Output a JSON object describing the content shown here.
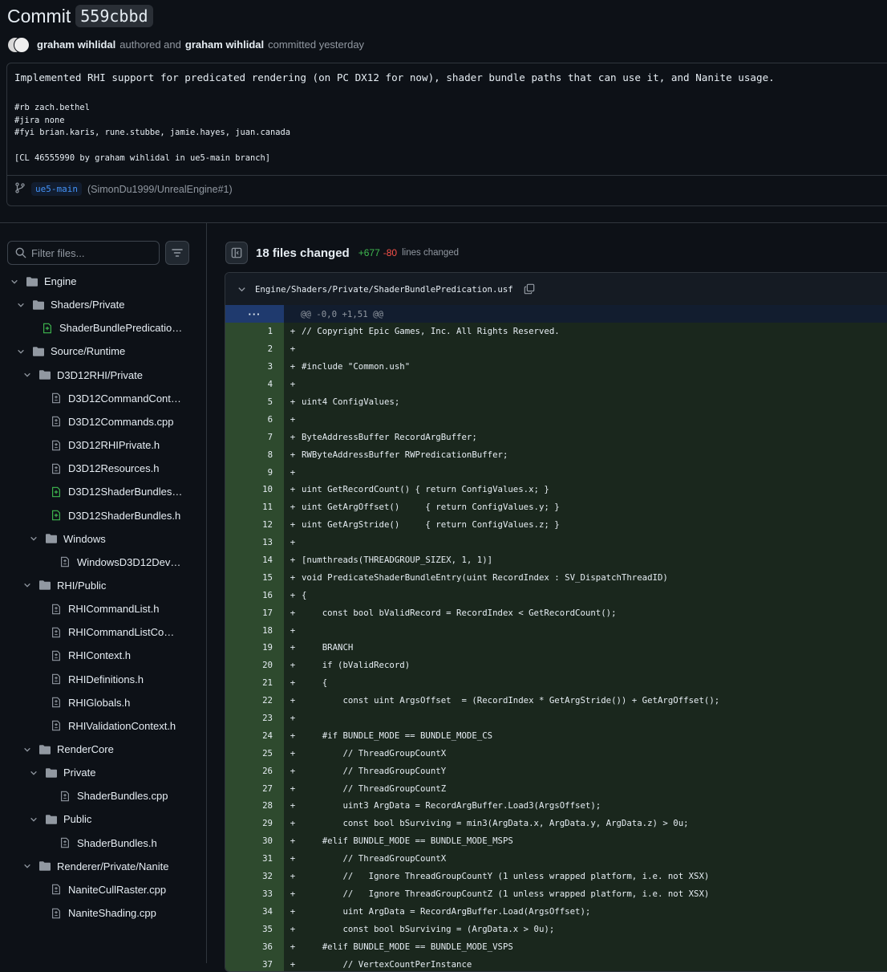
{
  "commit": {
    "title_prefix": "Commit",
    "sha": "559cbbd",
    "author": "graham wihlidal",
    "authored_text": "authored and",
    "committer": "graham wihlidal",
    "committed_text": "committed yesterday",
    "message_title": "Implemented RHI support for predicated rendering (on PC DX12 for now), shader bundle paths that can use it, and Nanite usage.",
    "message_body": "#rb zach.bethel\n#jira none\n#fyi brian.karis, rune.stubbe, jamie.hayes, juan.canada\n\n[CL 46555990 by graham wihlidal in ue5-main branch]",
    "branch": "ue5-main",
    "pr_ref": "(SimonDu1999/UnrealEngine#1)"
  },
  "sidebar": {
    "filter_placeholder": "Filter files...",
    "tree": [
      {
        "label": "Engine",
        "type": "folder",
        "depth": 0
      },
      {
        "label": "Shaders/Private",
        "type": "folder",
        "depth": 1
      },
      {
        "label": "ShaderBundlePredication....",
        "type": "file-added",
        "depth": 2
      },
      {
        "label": "Source/Runtime",
        "type": "folder",
        "depth": 1
      },
      {
        "label": "D3D12RHI/Private",
        "type": "folder",
        "depth": 2
      },
      {
        "label": "D3D12CommandContext.h",
        "type": "file-modified",
        "depth": 3
      },
      {
        "label": "D3D12Commands.cpp",
        "type": "file-modified",
        "depth": 3
      },
      {
        "label": "D3D12RHIPrivate.h",
        "type": "file-modified",
        "depth": 3
      },
      {
        "label": "D3D12Resources.h",
        "type": "file-modified",
        "depth": 3
      },
      {
        "label": "D3D12ShaderBundles.cpp",
        "type": "file-added",
        "depth": 3
      },
      {
        "label": "D3D12ShaderBundles.h",
        "type": "file-added",
        "depth": 3
      },
      {
        "label": "Windows",
        "type": "folder",
        "depth": 3
      },
      {
        "label": "WindowsD3D12Device.c...",
        "type": "file-modified",
        "depth": 4
      },
      {
        "label": "RHI/Public",
        "type": "folder",
        "depth": 2
      },
      {
        "label": "RHICommandList.h",
        "type": "file-modified",
        "depth": 3
      },
      {
        "label": "RHICommandListComma...",
        "type": "file-modified",
        "depth": 3
      },
      {
        "label": "RHIContext.h",
        "type": "file-modified",
        "depth": 3
      },
      {
        "label": "RHIDefinitions.h",
        "type": "file-modified",
        "depth": 3
      },
      {
        "label": "RHIGlobals.h",
        "type": "file-modified",
        "depth": 3
      },
      {
        "label": "RHIValidationContext.h",
        "type": "file-modified",
        "depth": 3
      },
      {
        "label": "RenderCore",
        "type": "folder",
        "depth": 2
      },
      {
        "label": "Private",
        "type": "folder",
        "depth": 3
      },
      {
        "label": "ShaderBundles.cpp",
        "type": "file-modified",
        "depth": 4
      },
      {
        "label": "Public",
        "type": "folder",
        "depth": 3
      },
      {
        "label": "ShaderBundles.h",
        "type": "file-modified",
        "depth": 4
      },
      {
        "label": "Renderer/Private/Nanite",
        "type": "folder",
        "depth": 2
      },
      {
        "label": "NaniteCullRaster.cpp",
        "type": "file-modified",
        "depth": 3
      },
      {
        "label": "NaniteShading.cpp",
        "type": "file-modified",
        "depth": 3
      }
    ]
  },
  "summary": {
    "files_changed": "18 files changed",
    "additions": "+677",
    "deletions": "-80",
    "lines_changed": "lines changed"
  },
  "diff": {
    "file_path": "Engine/Shaders/Private/ShaderBundlePredication.usf",
    "hunk_expand": "···",
    "hunk_header": "@@ -0,0 +1,51 @@",
    "lines": [
      {
        "n": "1",
        "t": "// Copyright Epic Games, Inc. All Rights Reserved."
      },
      {
        "n": "2",
        "t": ""
      },
      {
        "n": "3",
        "t": "#include \"Common.ush\""
      },
      {
        "n": "4",
        "t": ""
      },
      {
        "n": "5",
        "t": "uint4 ConfigValues;"
      },
      {
        "n": "6",
        "t": ""
      },
      {
        "n": "7",
        "t": "ByteAddressBuffer RecordArgBuffer;"
      },
      {
        "n": "8",
        "t": "RWByteAddressBuffer RWPredicationBuffer;"
      },
      {
        "n": "9",
        "t": ""
      },
      {
        "n": "10",
        "t": "uint GetRecordCount() { return ConfigValues.x; }"
      },
      {
        "n": "11",
        "t": "uint GetArgOffset()     { return ConfigValues.y; }"
      },
      {
        "n": "12",
        "t": "uint GetArgStride()     { return ConfigValues.z; }"
      },
      {
        "n": "13",
        "t": ""
      },
      {
        "n": "14",
        "t": "[numthreads(THREADGROUP_SIZEX, 1, 1)]"
      },
      {
        "n": "15",
        "t": "void PredicateShaderBundleEntry(uint RecordIndex : SV_DispatchThreadID)"
      },
      {
        "n": "16",
        "t": "{"
      },
      {
        "n": "17",
        "t": "    const bool bValidRecord = RecordIndex < GetRecordCount();"
      },
      {
        "n": "18",
        "t": ""
      },
      {
        "n": "19",
        "t": "    BRANCH"
      },
      {
        "n": "20",
        "t": "    if (bValidRecord)"
      },
      {
        "n": "21",
        "t": "    {"
      },
      {
        "n": "22",
        "t": "        const uint ArgsOffset  = (RecordIndex * GetArgStride()) + GetArgOffset();"
      },
      {
        "n": "23",
        "t": ""
      },
      {
        "n": "24",
        "t": "    #if BUNDLE_MODE == BUNDLE_MODE_CS"
      },
      {
        "n": "25",
        "t": "        // ThreadGroupCountX"
      },
      {
        "n": "26",
        "t": "        // ThreadGroupCountY"
      },
      {
        "n": "27",
        "t": "        // ThreadGroupCountZ"
      },
      {
        "n": "28",
        "t": "        uint3 ArgData = RecordArgBuffer.Load3(ArgsOffset);"
      },
      {
        "n": "29",
        "t": "        const bool bSurviving = min3(ArgData.x, ArgData.y, ArgData.z) > 0u;"
      },
      {
        "n": "30",
        "t": "    #elif BUNDLE_MODE == BUNDLE_MODE_MSPS"
      },
      {
        "n": "31",
        "t": "        // ThreadGroupCountX"
      },
      {
        "n": "32",
        "t": "        //   Ignore ThreadGroupCountY (1 unless wrapped platform, i.e. not XSX)"
      },
      {
        "n": "33",
        "t": "        //   Ignore ThreadGroupCountZ (1 unless wrapped platform, i.e. not XSX)"
      },
      {
        "n": "34",
        "t": "        uint ArgData = RecordArgBuffer.Load(ArgsOffset);"
      },
      {
        "n": "35",
        "t": "        const bool bSurviving = (ArgData.x > 0u);"
      },
      {
        "n": "36",
        "t": "    #elif BUNDLE_MODE == BUNDLE_MODE_VSPS"
      },
      {
        "n": "37",
        "t": "        // VertexCountPerInstance"
      }
    ]
  },
  "colors": {
    "background": "#0d1117",
    "border": "#30363d",
    "addition_line_number": "#2e4a2e",
    "addition_code": "#1a271d",
    "additions_text": "#3fb950",
    "deletions_text": "#f85149",
    "link": "#4493f8"
  }
}
